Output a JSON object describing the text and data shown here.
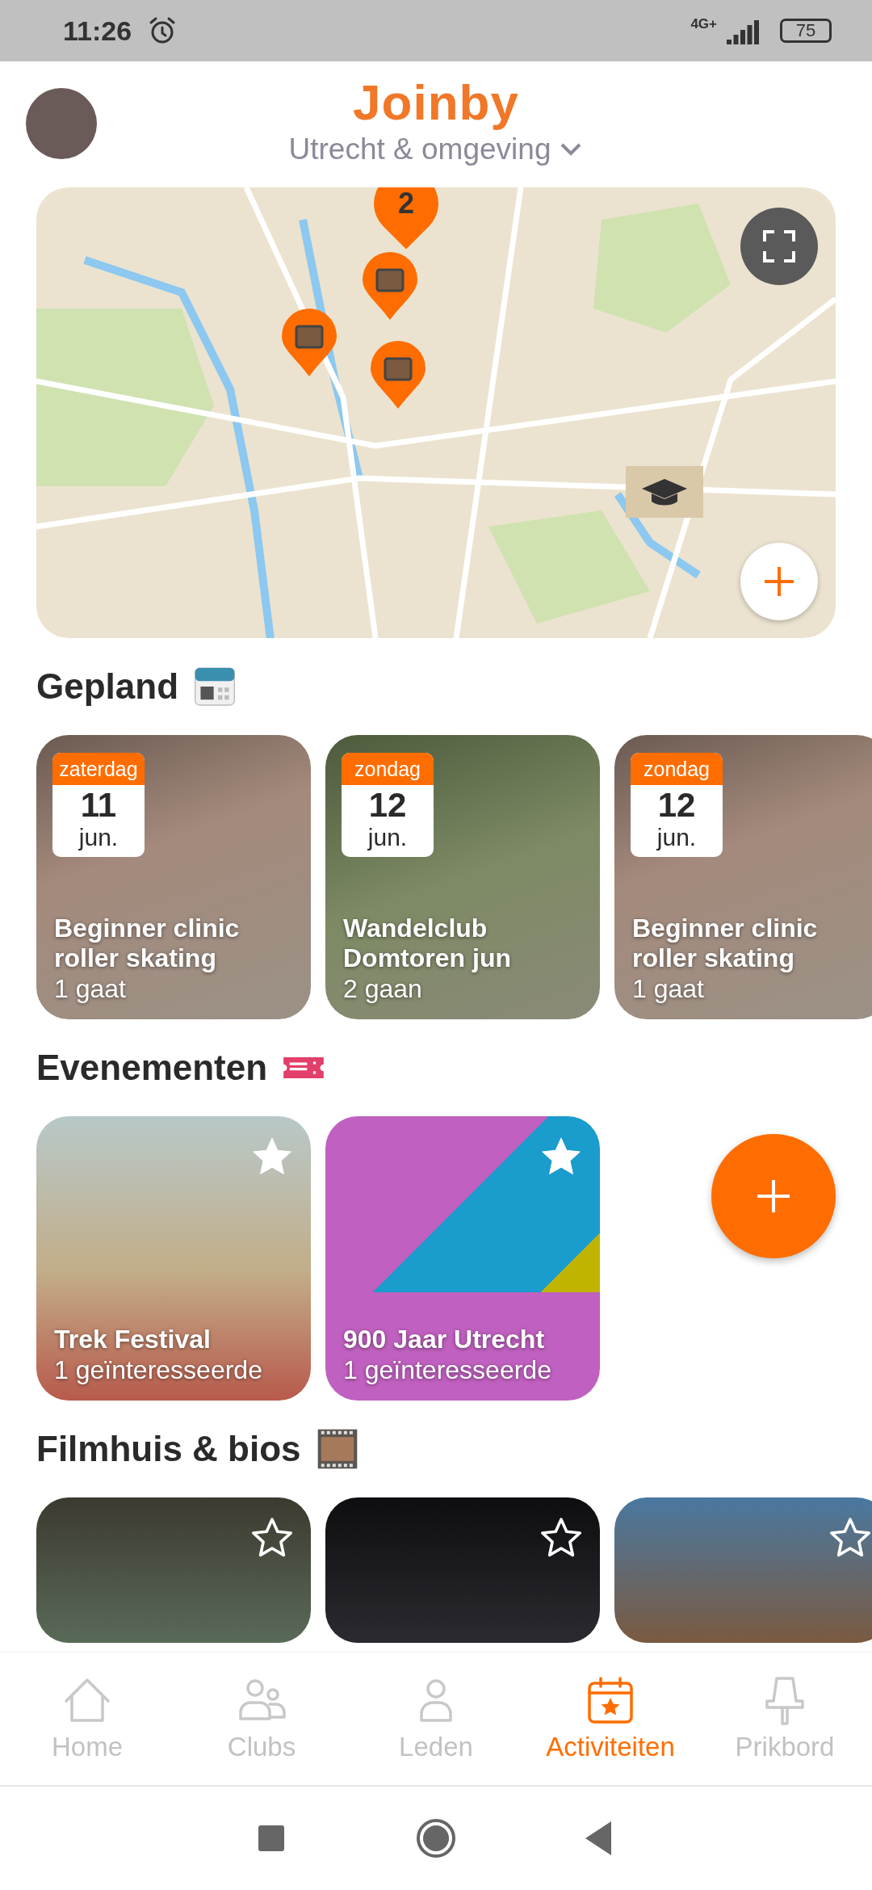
{
  "status_bar": {
    "time": "11:26",
    "network": "4G+",
    "battery": "75"
  },
  "header": {
    "logo": "Joinby",
    "region": "Utrecht & omgeving"
  },
  "map": {
    "cluster_count": "2"
  },
  "sections": [
    {
      "title": "Gepland",
      "cards": [
        {
          "kind": "activity",
          "weekday": "zaterdag",
          "day": "11",
          "month": "jun.",
          "title": "Beginner clinic roller skating",
          "subtitle": "1 gaat"
        },
        {
          "kind": "activity",
          "weekday": "zondag",
          "day": "12",
          "month": "jun.",
          "title": "Wandelclub Domtoren jun",
          "subtitle": "2 gaan"
        },
        {
          "kind": "activity",
          "weekday": "zondag",
          "day": "12",
          "month": "jun.",
          "title": "Beginner clinic roller skating",
          "subtitle": "1 gaat"
        }
      ]
    },
    {
      "title": "Evenementen",
      "cards": [
        {
          "kind": "event",
          "title": "Trek Festival",
          "subtitle": "1 geïnteresseerde",
          "favorite": true
        },
        {
          "kind": "event",
          "title": "900 Jaar Utrecht",
          "subtitle": "1 geïnteresseerde",
          "favorite": true
        }
      ]
    },
    {
      "title": "Filmhuis & bios",
      "cards": [
        {
          "kind": "venue",
          "favorite": false
        },
        {
          "kind": "venue",
          "favorite": false
        },
        {
          "kind": "venue",
          "favorite": false
        }
      ]
    }
  ],
  "nav": [
    {
      "label": "Home",
      "selected": false
    },
    {
      "label": "Clubs",
      "selected": false
    },
    {
      "label": "Leden",
      "selected": false
    },
    {
      "label": "Activiteiten",
      "selected": true
    },
    {
      "label": "Prikbord",
      "selected": false
    }
  ]
}
